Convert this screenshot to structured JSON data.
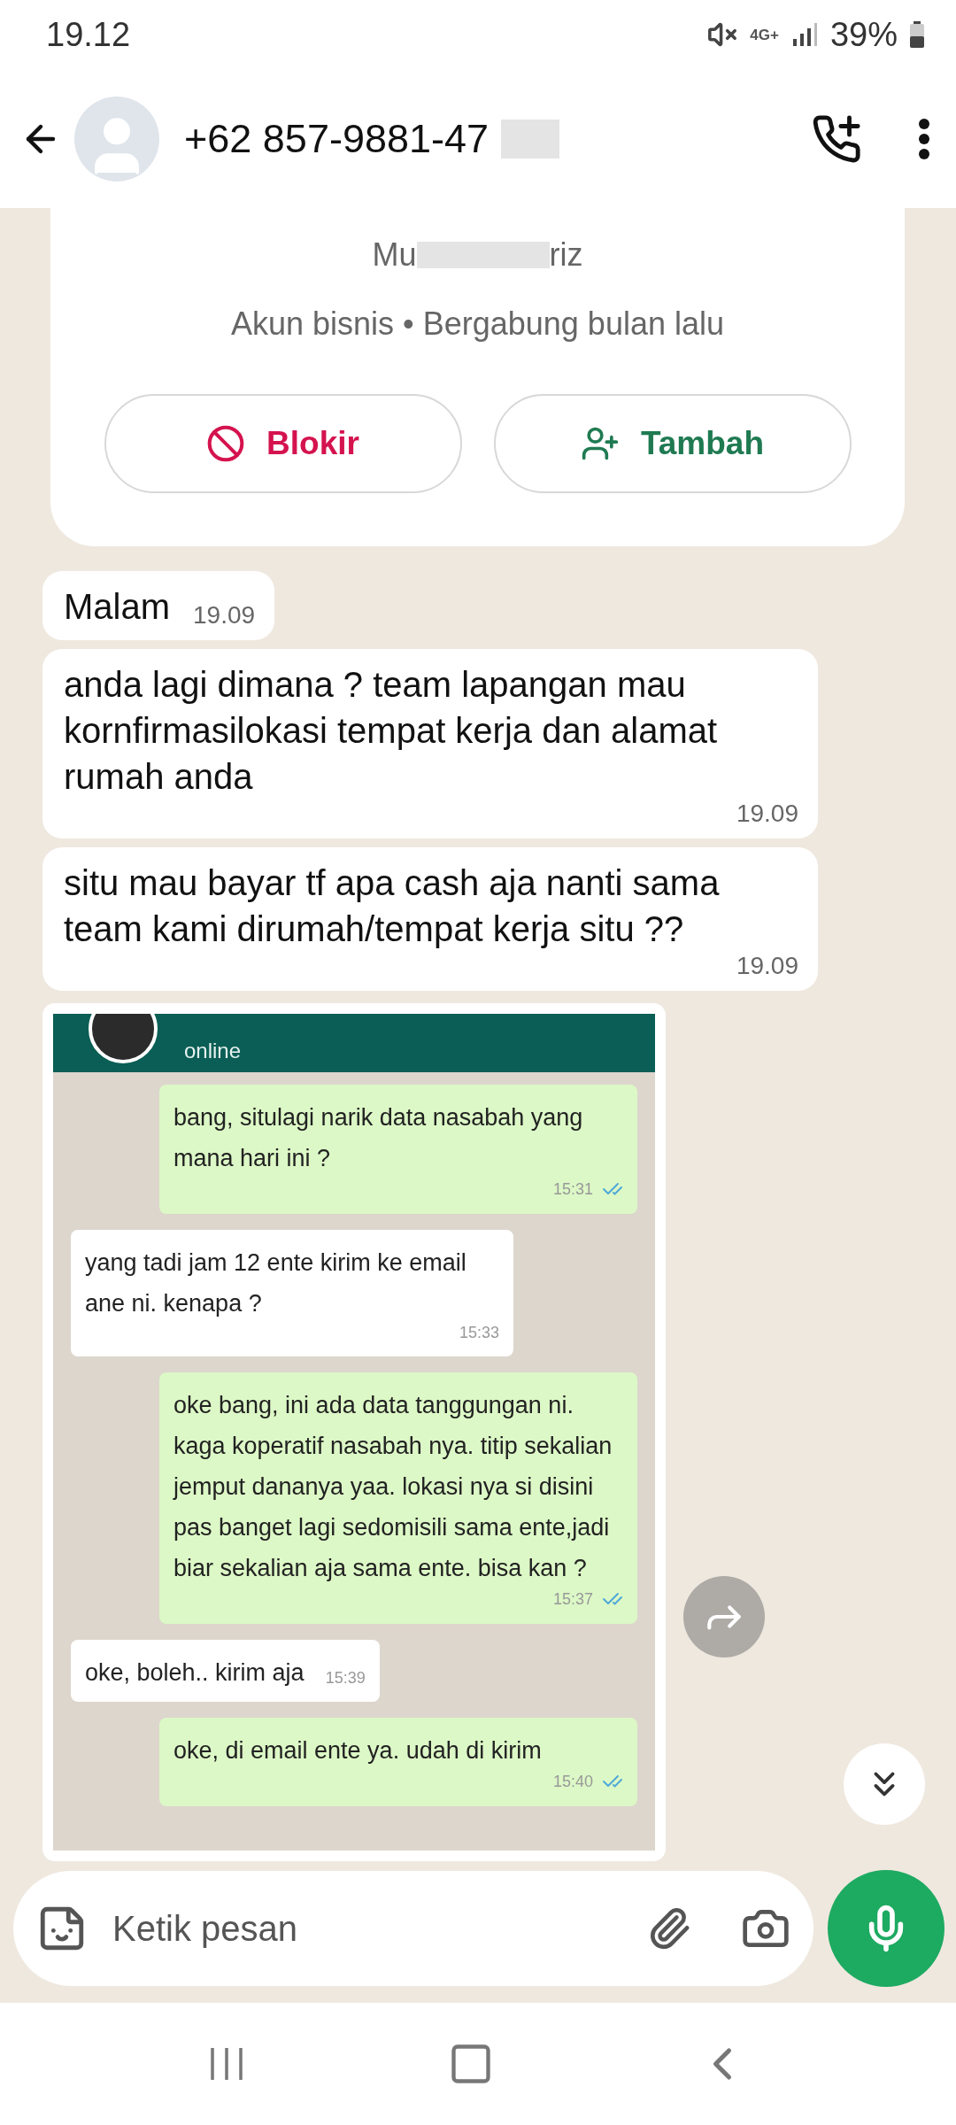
{
  "status_bar": {
    "time": "19.12",
    "network": "4G+",
    "battery": "39%"
  },
  "header": {
    "title": "+62 857-9881-47"
  },
  "contact_card": {
    "name_start": "Mu",
    "name_end": "riz",
    "info": "Akun bisnis • Bergabung bulan lalu",
    "buttons": [
      {
        "kind": "block",
        "label": "Blokir"
      },
      {
        "kind": "add",
        "label": "Tambah"
      }
    ]
  },
  "messages": [
    {
      "kind": "text",
      "text": "Malam",
      "time": "19.09"
    },
    {
      "kind": "text",
      "text": "anda lagi dimana ? team lapangan mau kornfirmasilokasi tempat kerja dan alamat rumah anda",
      "time": "19.09"
    },
    {
      "kind": "text",
      "text": "situ mau bayar tf apa cash aja nanti sama team kami dirumah/tempat kerja situ ??",
      "time": "19.09"
    },
    {
      "kind": "image",
      "status": "online",
      "messages": [
        {
          "kind": "sent",
          "text": "bang, situlagi narik data nasabah yang mana hari ini ?",
          "time": "15:31"
        },
        {
          "kind": "received",
          "text": "yang tadi jam 12 ente kirim ke email ane ni. kenapa ?",
          "time": "15:33"
        },
        {
          "kind": "sent",
          "text": "oke bang, ini ada data tanggungan ni. kaga koperatif nasabah nya. titip sekalian jemput dananya yaa. lokasi nya si disini pas banget lagi sedomisili sama ente,jadi biar sekalian aja sama ente. bisa kan ?",
          "time": "15:37"
        },
        {
          "kind": "received",
          "text": "oke, boleh.. kirim aja",
          "time": "15:39"
        },
        {
          "kind": "sent",
          "text": "oke, di email ente ya. udah di kirim",
          "time": "15:40"
        }
      ]
    }
  ],
  "composer": {
    "placeholder": "Ketik pesan"
  }
}
